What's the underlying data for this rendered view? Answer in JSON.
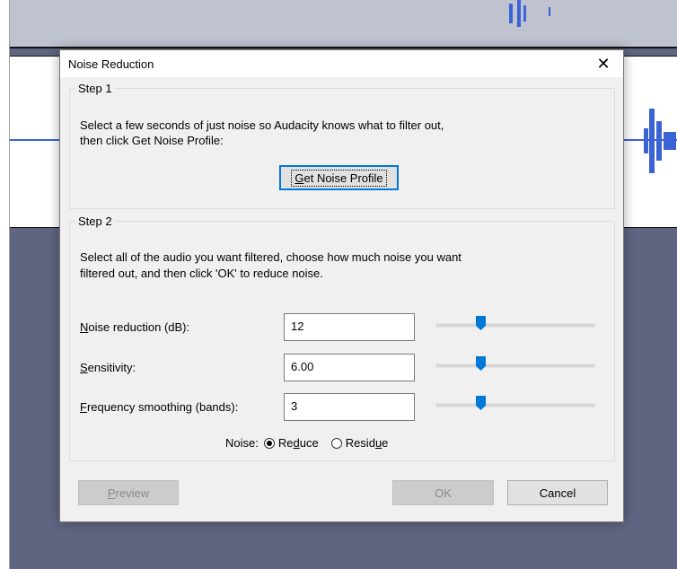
{
  "dialog": {
    "title": "Noise Reduction",
    "close_glyph": "✕"
  },
  "step1": {
    "legend": "Step 1",
    "instructions_line1": "Select a few seconds of just noise so Audacity knows what to filter out,",
    "instructions_line2": "then click Get Noise Profile:",
    "get_profile_button": {
      "mnemonic": "G",
      "rest": "et Noise Profile"
    }
  },
  "step2": {
    "legend": "Step 2",
    "instructions_line1": "Select all of the audio you want filtered, choose how much noise you want",
    "instructions_line2": "filtered out, and then click 'OK' to reduce noise.",
    "noise_reduction": {
      "label_mnemonic": "N",
      "label_rest": "oise reduction (dB):",
      "value": "12",
      "slider_fraction": 0.27
    },
    "sensitivity": {
      "label_mnemonic": "S",
      "label_rest": "ensitivity:",
      "value": "6.00",
      "slider_fraction": 0.27
    },
    "freq_smoothing": {
      "label_mnemonic": "F",
      "label_rest": "requency smoothing (bands):",
      "value": "3",
      "slider_fraction": 0.27
    },
    "noise_label": "Noise:",
    "reduce": {
      "pre": "Re",
      "mnemonic": "d",
      "post": "uce",
      "checked": true
    },
    "residue": {
      "pre": "Resid",
      "mnemonic": "u",
      "post": "e",
      "checked": false
    }
  },
  "buttons": {
    "preview": {
      "mnemonic": "P",
      "rest": "review"
    },
    "ok": "OK",
    "cancel": "Cancel"
  },
  "colors": {
    "accent": "#0078d7",
    "waveform": "#3b63d6",
    "background": "#5f6581"
  }
}
